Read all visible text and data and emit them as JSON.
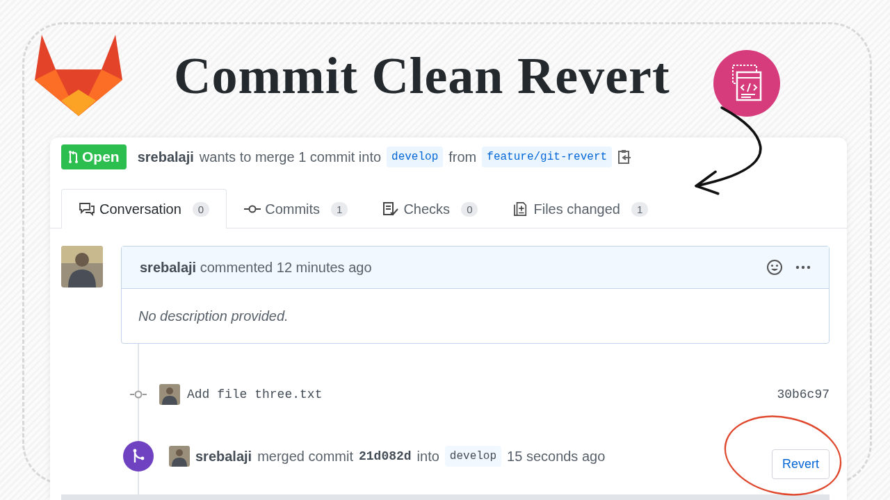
{
  "title": "Commit Clean Revert",
  "pull_request": {
    "state": "Open",
    "author": "srebalaji",
    "summary_1": "wants to merge 1 commit into",
    "base_branch": "develop",
    "summary_2": "from",
    "head_branch": "feature/git-revert"
  },
  "tabs": [
    {
      "kind": "conversation",
      "label": "Conversation",
      "count": "0",
      "selected": true
    },
    {
      "kind": "commits",
      "label": "Commits",
      "count": "1",
      "selected": false
    },
    {
      "kind": "checks",
      "label": "Checks",
      "count": "0",
      "selected": false
    },
    {
      "kind": "files",
      "label": "Files changed",
      "count": "1",
      "selected": false
    }
  ],
  "comment": {
    "author": "srebalaji",
    "action": "commented 12 minutes ago",
    "body": "No description provided."
  },
  "timeline": [
    {
      "kind": "commit",
      "message": "Add file three.txt",
      "sha": "30b6c97"
    },
    {
      "kind": "merge",
      "author": "srebalaji",
      "text_1": "merged commit",
      "commit": "21d082d",
      "text_2": "into",
      "branch": "develop",
      "time": "15 seconds ago",
      "button": "Revert"
    }
  ]
}
